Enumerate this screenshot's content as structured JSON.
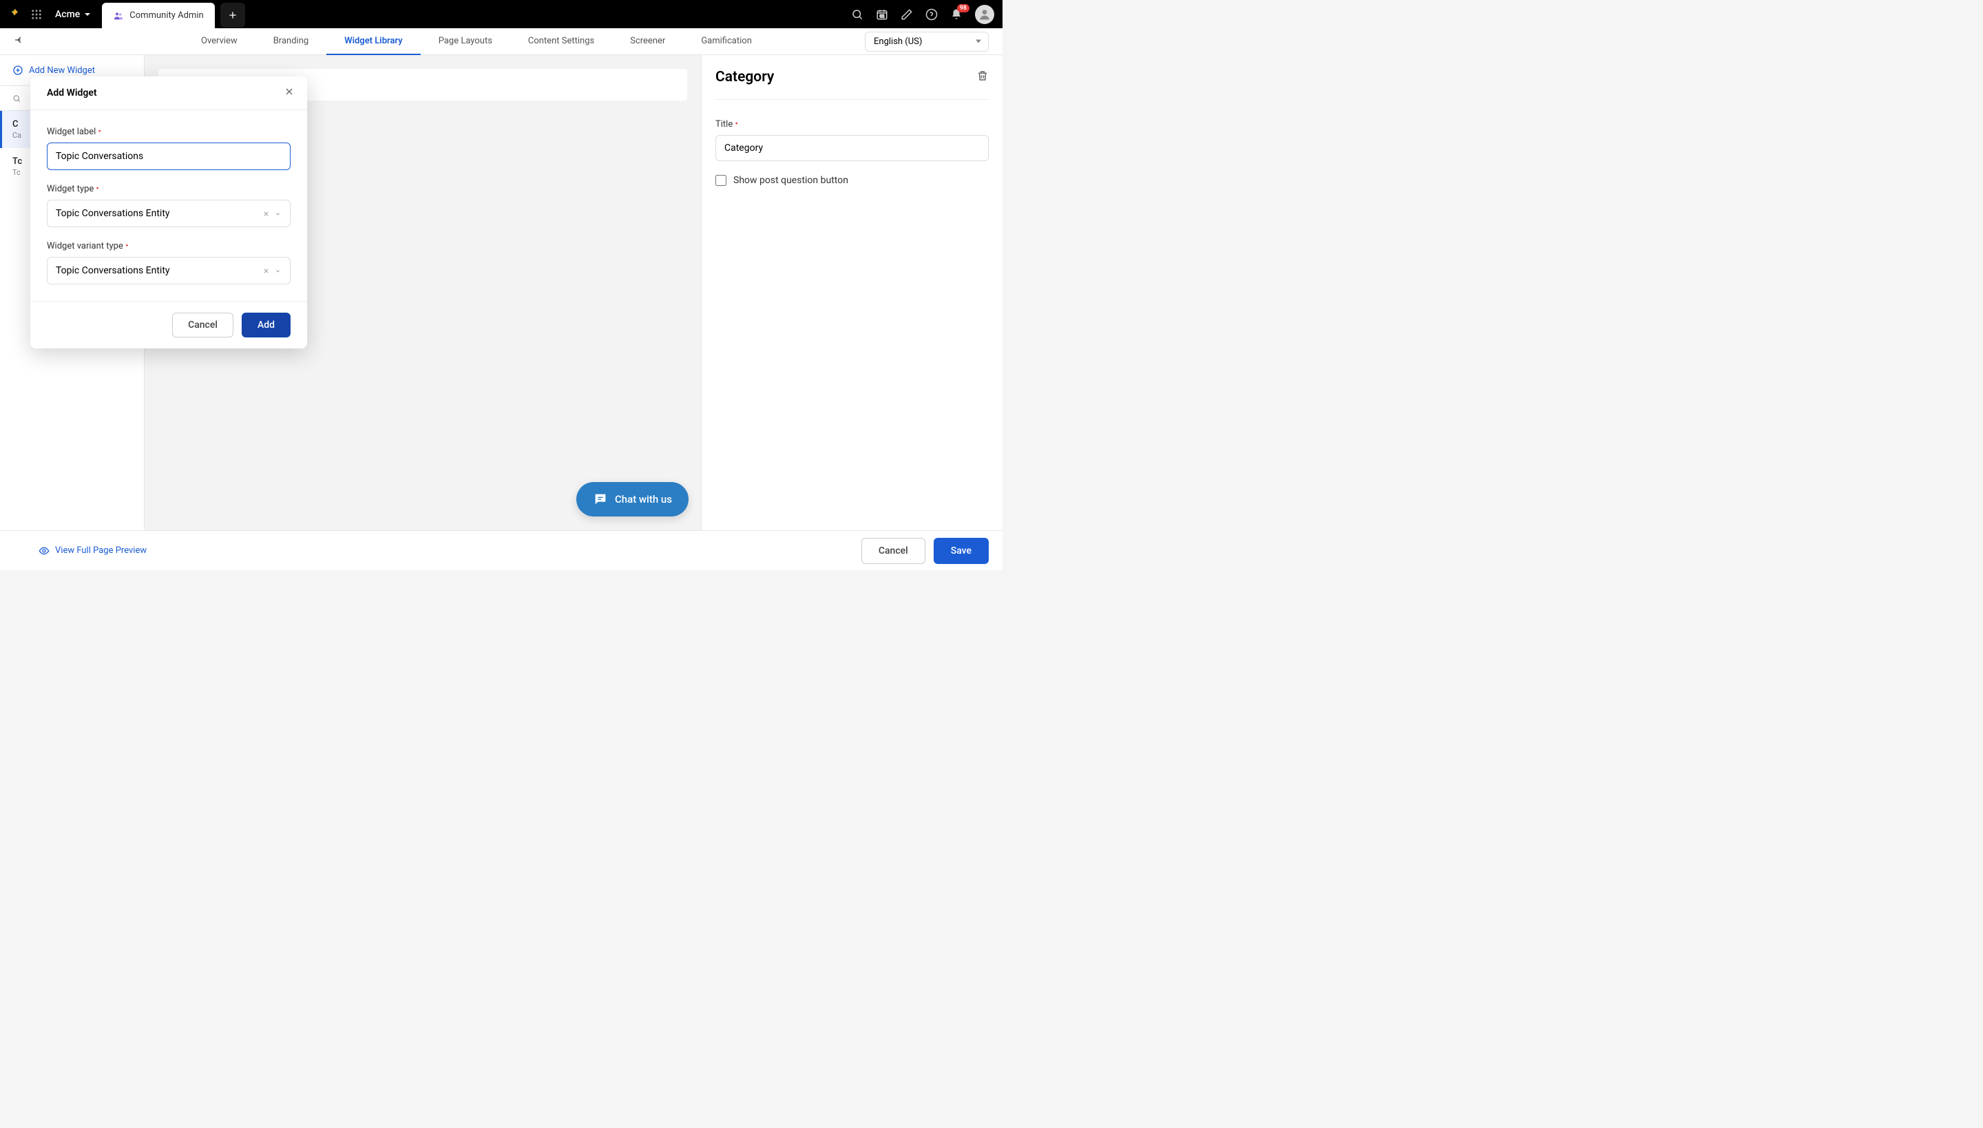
{
  "header": {
    "workspace": "Acme",
    "tab_label": "Community Admin",
    "notification_count": "98"
  },
  "nav": {
    "tabs": [
      "Overview",
      "Branding",
      "Widget Library",
      "Page Layouts",
      "Content Settings",
      "Screener",
      "Gamification"
    ],
    "active_index": 2,
    "language": "English (US)"
  },
  "sidebar": {
    "add_link": "Add New Widget",
    "search_placeholder": "",
    "items": [
      {
        "name": "C",
        "sub": "Ca"
      },
      {
        "name": "Tc",
        "sub": "Tc"
      }
    ]
  },
  "right_panel": {
    "title": "Category",
    "title_label": "Title",
    "title_value": "Category",
    "checkbox_label": "Show post question button"
  },
  "footer": {
    "preview": "View Full Page Preview",
    "cancel": "Cancel",
    "save": "Save"
  },
  "chat": {
    "label": "Chat with us"
  },
  "modal": {
    "title": "Add Widget",
    "label_label": "Widget label",
    "label_value": "Topic Conversations",
    "type_label": "Widget type",
    "type_value": "Topic Conversations Entity",
    "variant_label": "Widget variant type",
    "variant_value": "Topic Conversations Entity",
    "cancel": "Cancel",
    "add": "Add"
  }
}
